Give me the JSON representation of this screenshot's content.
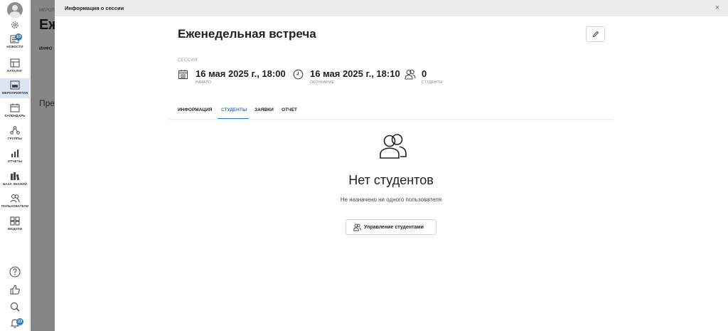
{
  "sidebar": {
    "news_badge": "10",
    "items": [
      {
        "label": "НОВОСТИ",
        "icon": "news-icon"
      },
      {
        "label": "КАТАЛОГ",
        "icon": "catalog-icon"
      },
      {
        "label": "МЕРОПРИЯТИЯ",
        "icon": "events-icon"
      },
      {
        "label": "КАЛЕНДАРЬ",
        "icon": "calendar-icon"
      },
      {
        "label": "ГРУППЫ",
        "icon": "groups-icon"
      },
      {
        "label": "ОТЧЕТЫ",
        "icon": "reports-icon"
      },
      {
        "label": "БАЗА ЗНАНИЙ",
        "icon": "knowledge-base-icon"
      },
      {
        "label": "ПОЛЬЗОВАТЕЛИ",
        "icon": "users-icon"
      },
      {
        "label": "МОДУЛИ",
        "icon": "modules-icon"
      }
    ],
    "active_item": "МЕРОПРИЯТИЯ",
    "notifications_badge": "23",
    "accent_color": "#3477c7"
  },
  "background": {
    "crumb": "МЕРОП",
    "title": "Еж",
    "tab": "ИНФО",
    "section": "Пре"
  },
  "modal": {
    "title": "Информация о сессии",
    "close": "×",
    "session_name": "Еженедельная встреча",
    "session_caption": "СЕССИЯ",
    "start": {
      "value": "16 мая 2025 г., 18:00",
      "label": "НАЧАЛО"
    },
    "end": {
      "value": "16 мая 2025 г., 18:10",
      "label": "ОКОНЧАНИЕ"
    },
    "students": {
      "value": "0",
      "label": "СТУДЕНТЫ"
    },
    "tabs": [
      "ИНФОРМАЦИЯ",
      "СТУДЕНТЫ",
      "ЗАЯВКИ",
      "ОТЧЕТ"
    ],
    "active_tab": "СТУДЕНТЫ",
    "empty": {
      "title": "Нет студентов",
      "subtitle": "Не назначено ни одного пользователя",
      "button": "Управление студентами"
    }
  }
}
